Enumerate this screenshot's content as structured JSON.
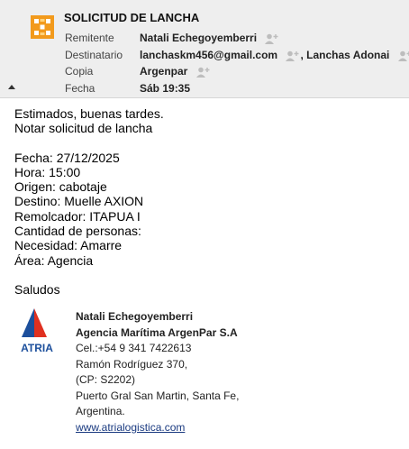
{
  "email": {
    "subject": "SOLICITUD DE LANCHA",
    "from_label": "Remitente",
    "from_value": "Natali Echegoyemberri",
    "to_label": "Destinatario",
    "to_value1": "lanchaskm456@gmail.com",
    "to_value2": ", Lanchas Adonai",
    "cc_label": "Copia",
    "cc_value": "Argenpar",
    "date_label": "Fecha",
    "date_value": "Sáb 19:35"
  },
  "body": {
    "greeting": "Estimados, buenas tardes.",
    "intro": "Notar solicitud de lancha",
    "fields": [
      "Fecha: 27/12/2025",
      "Hora: 15:00",
      "Origen: cabotaje",
      "Destino: Muelle AXION",
      "Remolcador: ITAPUA I",
      "Cantidad de personas:",
      "Necesidad: Amarre",
      "Área: Agencia"
    ],
    "closing": "Saludos"
  },
  "signature": {
    "logo_text": "ATRIA",
    "name": "Natali Echegoyemberri",
    "company": "Agencia Marítima ArgenPar S.A",
    "phone": "Cel.:+54 9 341 7422613",
    "address1": "Ramón Rodríguez 370,",
    "address2": "(CP: S2202)",
    "address3": "Puerto Gral San Martin, Santa Fe,",
    "address4": "Argentina.",
    "website": "www.atrialogistica.com"
  },
  "colors": {
    "header_bg": "#eeeeee",
    "logo_orange": "#f0a020",
    "atria_blue": "#1c4f9c",
    "atria_red": "#e03020"
  }
}
